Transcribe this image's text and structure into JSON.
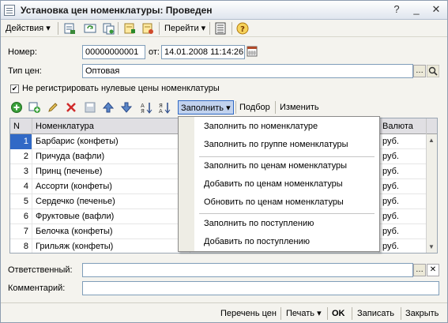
{
  "window": {
    "title": "Установка цен номенклатуры: Проведен"
  },
  "toolbar": {
    "actions": "Действия",
    "go": "Перейти"
  },
  "form": {
    "number_label": "Номер:",
    "number_value": "00000000001",
    "date_label": "от:",
    "date_value": "14.01.2008 11:14:26",
    "price_type_label": "Тип цен:",
    "price_type_value": "Оптовая",
    "no_zero_label": "Не регистрировать нулевые цены номенклатуры",
    "responsible_label": "Ответственный:",
    "responsible_value": "",
    "comment_label": "Комментарий:",
    "comment_value": ""
  },
  "grid_toolbar": {
    "fill": "Заполнить",
    "select": "Подбор",
    "change": "Изменить"
  },
  "grid": {
    "columns": {
      "n": "N",
      "nomenclature": "Номенклатура",
      "currency": "Валюта"
    },
    "rows": [
      {
        "n": "1",
        "name": "Барбарис (конфеты)",
        "currency": "руб."
      },
      {
        "n": "2",
        "name": "Причуда (вафли)",
        "currency": "руб."
      },
      {
        "n": "3",
        "name": "Принц (печенье)",
        "currency": "руб."
      },
      {
        "n": "4",
        "name": "Ассорти (конфеты)",
        "currency": "руб."
      },
      {
        "n": "5",
        "name": "Сердечко (печенье)",
        "currency": "руб."
      },
      {
        "n": "6",
        "name": "Фруктовые (вафли)",
        "currency": "руб."
      },
      {
        "n": "7",
        "name": "Белочка (конфеты)",
        "currency": "руб."
      },
      {
        "n": "8",
        "name": "Грильяж (конфеты)",
        "currency": "руб."
      }
    ]
  },
  "fill_menu": {
    "items": [
      "Заполнить по номенклатуре",
      "Заполнить по группе номенклатуры",
      "Заполнить по ценам номенклатуры",
      "Добавить по ценам номенклатуры",
      "Обновить по ценам номенклатуры",
      "Заполнить по поступлению",
      "Добавить по поступлению"
    ]
  },
  "footer": {
    "price_list": "Перечень цен",
    "print": "Печать",
    "ok": "OK",
    "save": "Записать",
    "close": "Закрыть"
  }
}
